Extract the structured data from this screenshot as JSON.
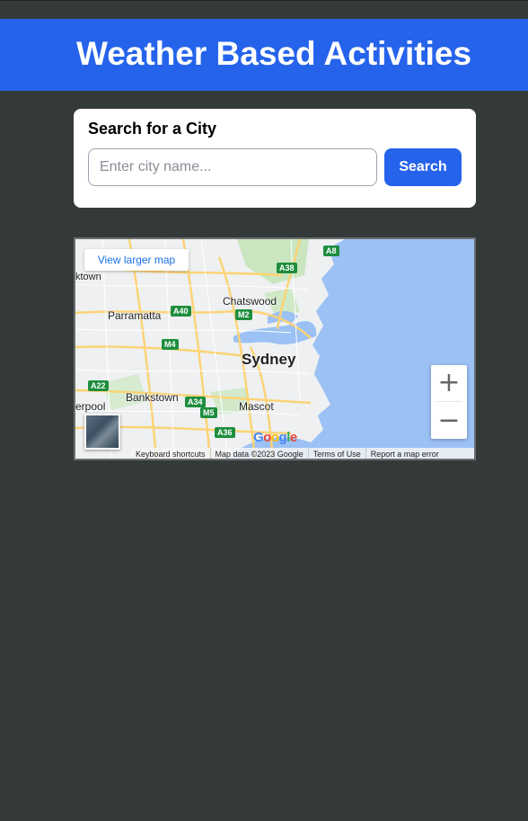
{
  "header": {
    "title": "Weather Based Activities"
  },
  "search": {
    "title": "Search for a City",
    "placeholder": "Enter city name...",
    "value": "",
    "button_label": "Search"
  },
  "map": {
    "view_larger": "View larger map",
    "zoom_in": "+",
    "zoom_out": "−",
    "google_logo": "Google",
    "places": {
      "sydney": "Sydney",
      "chatswood": "Chatswood",
      "parramatta": "Parramatta",
      "bankstown": "Bankstown",
      "mascot": "Mascot",
      "ktown": "ktown",
      "erpool": "erpool"
    },
    "routes": {
      "a8": "A8",
      "a38": "A38",
      "a40": "A40",
      "m2": "M2",
      "m4": "M4",
      "a22": "A22",
      "a34": "A34",
      "m5": "M5",
      "a36": "A36"
    },
    "attribution": {
      "shortcuts": "Keyboard shortcuts",
      "data": "Map data ©2023 Google",
      "terms": "Terms of Use",
      "report": "Report a map error"
    }
  },
  "colors": {
    "header_bg": "#2563eb",
    "page_bg": "#343a3a",
    "button_bg": "#2563eb",
    "water": "#9bc1f5",
    "road": "#fcd372"
  }
}
